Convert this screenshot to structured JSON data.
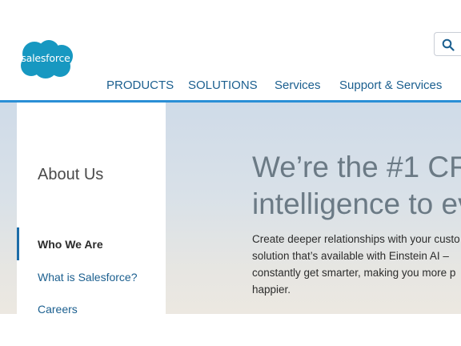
{
  "brand": {
    "logo_text": "salesforce",
    "logo_color": "#1798c1"
  },
  "nav": {
    "items": [
      {
        "label": "PRODUCTS"
      },
      {
        "label": "SOLUTIONS"
      },
      {
        "label": "Services"
      },
      {
        "label": "Support & Services"
      }
    ]
  },
  "sidebar": {
    "title": "About Us",
    "links": [
      {
        "label": "Who We Are",
        "active": true
      },
      {
        "label": "What is Salesforce?",
        "active": false
      },
      {
        "label": "Careers",
        "active": false
      }
    ]
  },
  "hero": {
    "headline_lines": [
      "We’re the #1 CR",
      "intelligence to ev"
    ],
    "body_lines": [
      "Create deeper relationships with your custo",
      "solution that’s available with Einstein AI –",
      "constantly get smarter, making you more p",
      "happier."
    ]
  },
  "colors": {
    "accent": "#2a8fd6",
    "link": "#1b5f8f",
    "active_bar": "#1c6ca8"
  }
}
